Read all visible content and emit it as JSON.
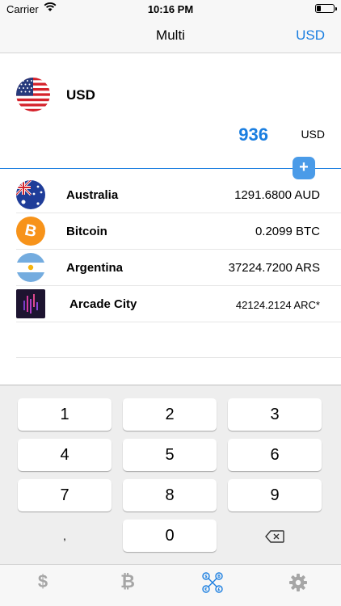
{
  "status_bar": {
    "carrier": "Carrier",
    "time": "10:16 PM"
  },
  "nav": {
    "title": "Multi",
    "right_button": "USD"
  },
  "base": {
    "code": "USD",
    "amount": "936",
    "unit": "USD",
    "add_symbol": "+"
  },
  "currencies": [
    {
      "name": "Australia",
      "value": "1291.6800 AUD",
      "icon": "australia-flag-icon"
    },
    {
      "name": "Bitcoin",
      "value": "0.2099 BTC",
      "icon": "bitcoin-icon",
      "icon_glyph": "B"
    },
    {
      "name": "Argentina",
      "value": "37224.7200 ARS",
      "icon": "argentina-flag-icon"
    },
    {
      "name": "Arcade City",
      "value": "42124.2124 ARC*",
      "icon": "arcade-city-icon"
    }
  ],
  "keypad": {
    "keys": [
      "1",
      "2",
      "3",
      "4",
      "5",
      "6",
      "7",
      "8",
      "9",
      ",",
      "0"
    ],
    "backspace_icon": "backspace-icon"
  },
  "tabs": [
    {
      "icon": "dollar-icon",
      "glyph": "$"
    },
    {
      "icon": "bitcoin-tab-icon",
      "glyph": "₿"
    },
    {
      "icon": "multi-convert-icon"
    },
    {
      "icon": "gear-icon"
    }
  ],
  "colors": {
    "accent": "#1a7ee0",
    "bitcoin": "#f7931a",
    "tab_inactive": "#a6a6a6"
  }
}
